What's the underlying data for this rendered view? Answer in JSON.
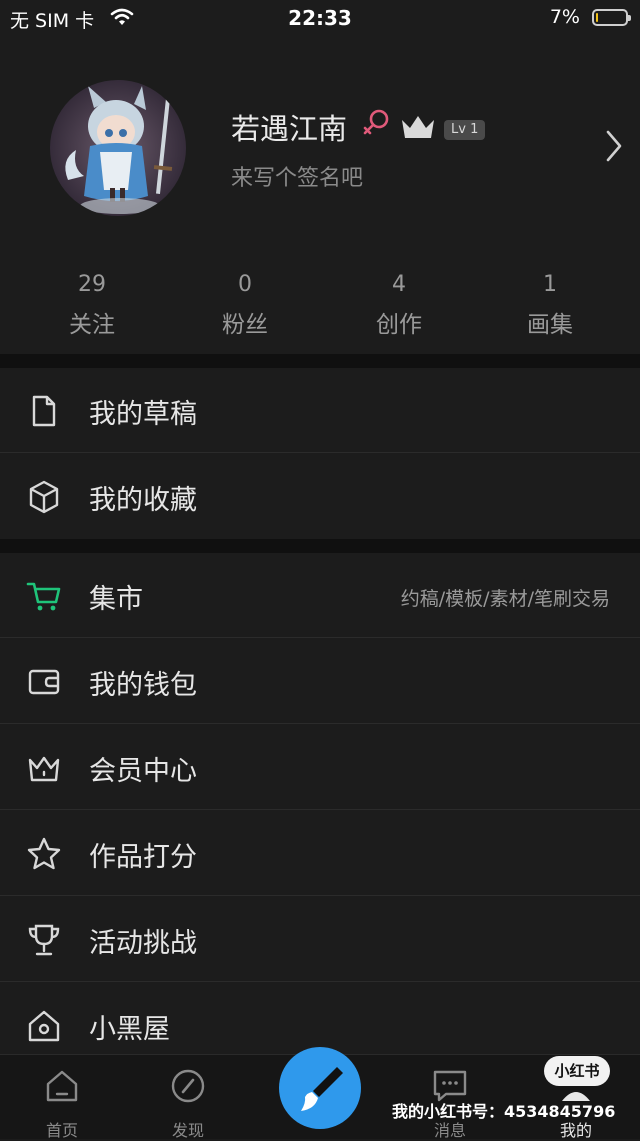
{
  "status_bar": {
    "carrier": "无 SIM 卡",
    "time": "22:33",
    "battery_pct": "7%",
    "battery_level": 0.07
  },
  "profile": {
    "username": "若遇江南",
    "level": "Lv 1",
    "signature": "来写个签名吧"
  },
  "stats": [
    {
      "value": "29",
      "label": "关注"
    },
    {
      "value": "0",
      "label": "粉丝"
    },
    {
      "value": "4",
      "label": "创作"
    },
    {
      "value": "1",
      "label": "画集"
    }
  ],
  "menu": [
    {
      "label": "我的草稿",
      "icon": "document-icon"
    },
    {
      "label": "我的收藏",
      "icon": "box-icon"
    },
    {
      "label": "集市",
      "icon": "cart-icon",
      "extra": "约稿/模板/素材/笔刷交易"
    },
    {
      "label": "我的钱包",
      "icon": "wallet-icon"
    },
    {
      "label": "会员中心",
      "icon": "crown-icon"
    },
    {
      "label": "作品打分",
      "icon": "star-icon"
    },
    {
      "label": "活动挑战",
      "icon": "trophy-icon"
    },
    {
      "label": "小黑屋",
      "icon": "home-lock-icon"
    }
  ],
  "tabs": [
    {
      "label": "首页",
      "icon": "home-icon"
    },
    {
      "label": "发现",
      "icon": "compass-icon"
    },
    {
      "label": "消息",
      "icon": "message-icon"
    },
    {
      "label": "我的",
      "icon": "person-icon"
    }
  ],
  "watermark": {
    "badge": "小红书",
    "text": "我的小红书号：4534845796"
  },
  "colors": {
    "background": "#1c1c1c",
    "accent_green": "#1fc47a",
    "create_blue": "#2f99ec",
    "gender_pink": "#e05a7a"
  }
}
